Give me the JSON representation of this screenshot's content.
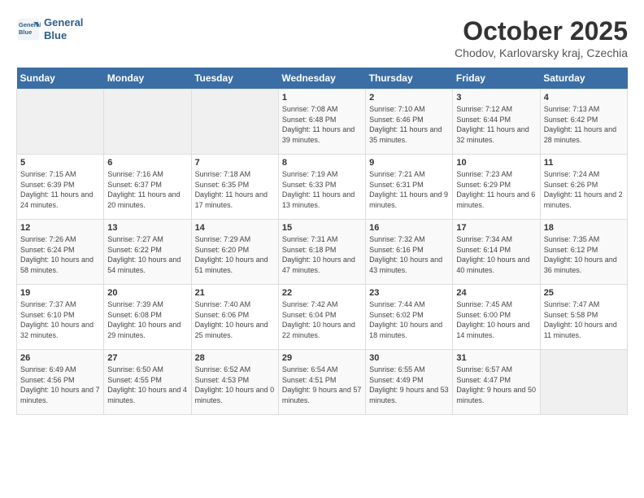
{
  "logo": {
    "line1": "General",
    "line2": "Blue"
  },
  "title": "October 2025",
  "location": "Chodov, Karlovarsky kraj, Czechia",
  "weekdays": [
    "Sunday",
    "Monday",
    "Tuesday",
    "Wednesday",
    "Thursday",
    "Friday",
    "Saturday"
  ],
  "weeks": [
    [
      {
        "day": "",
        "info": ""
      },
      {
        "day": "",
        "info": ""
      },
      {
        "day": "",
        "info": ""
      },
      {
        "day": "1",
        "info": "Sunrise: 7:08 AM\nSunset: 6:48 PM\nDaylight: 11 hours and 39 minutes."
      },
      {
        "day": "2",
        "info": "Sunrise: 7:10 AM\nSunset: 6:46 PM\nDaylight: 11 hours and 35 minutes."
      },
      {
        "day": "3",
        "info": "Sunrise: 7:12 AM\nSunset: 6:44 PM\nDaylight: 11 hours and 32 minutes."
      },
      {
        "day": "4",
        "info": "Sunrise: 7:13 AM\nSunset: 6:42 PM\nDaylight: 11 hours and 28 minutes."
      }
    ],
    [
      {
        "day": "5",
        "info": "Sunrise: 7:15 AM\nSunset: 6:39 PM\nDaylight: 11 hours and 24 minutes."
      },
      {
        "day": "6",
        "info": "Sunrise: 7:16 AM\nSunset: 6:37 PM\nDaylight: 11 hours and 20 minutes."
      },
      {
        "day": "7",
        "info": "Sunrise: 7:18 AM\nSunset: 6:35 PM\nDaylight: 11 hours and 17 minutes."
      },
      {
        "day": "8",
        "info": "Sunrise: 7:19 AM\nSunset: 6:33 PM\nDaylight: 11 hours and 13 minutes."
      },
      {
        "day": "9",
        "info": "Sunrise: 7:21 AM\nSunset: 6:31 PM\nDaylight: 11 hours and 9 minutes."
      },
      {
        "day": "10",
        "info": "Sunrise: 7:23 AM\nSunset: 6:29 PM\nDaylight: 11 hours and 6 minutes."
      },
      {
        "day": "11",
        "info": "Sunrise: 7:24 AM\nSunset: 6:26 PM\nDaylight: 11 hours and 2 minutes."
      }
    ],
    [
      {
        "day": "12",
        "info": "Sunrise: 7:26 AM\nSunset: 6:24 PM\nDaylight: 10 hours and 58 minutes."
      },
      {
        "day": "13",
        "info": "Sunrise: 7:27 AM\nSunset: 6:22 PM\nDaylight: 10 hours and 54 minutes."
      },
      {
        "day": "14",
        "info": "Sunrise: 7:29 AM\nSunset: 6:20 PM\nDaylight: 10 hours and 51 minutes."
      },
      {
        "day": "15",
        "info": "Sunrise: 7:31 AM\nSunset: 6:18 PM\nDaylight: 10 hours and 47 minutes."
      },
      {
        "day": "16",
        "info": "Sunrise: 7:32 AM\nSunset: 6:16 PM\nDaylight: 10 hours and 43 minutes."
      },
      {
        "day": "17",
        "info": "Sunrise: 7:34 AM\nSunset: 6:14 PM\nDaylight: 10 hours and 40 minutes."
      },
      {
        "day": "18",
        "info": "Sunrise: 7:35 AM\nSunset: 6:12 PM\nDaylight: 10 hours and 36 minutes."
      }
    ],
    [
      {
        "day": "19",
        "info": "Sunrise: 7:37 AM\nSunset: 6:10 PM\nDaylight: 10 hours and 32 minutes."
      },
      {
        "day": "20",
        "info": "Sunrise: 7:39 AM\nSunset: 6:08 PM\nDaylight: 10 hours and 29 minutes."
      },
      {
        "day": "21",
        "info": "Sunrise: 7:40 AM\nSunset: 6:06 PM\nDaylight: 10 hours and 25 minutes."
      },
      {
        "day": "22",
        "info": "Sunrise: 7:42 AM\nSunset: 6:04 PM\nDaylight: 10 hours and 22 minutes."
      },
      {
        "day": "23",
        "info": "Sunrise: 7:44 AM\nSunset: 6:02 PM\nDaylight: 10 hours and 18 minutes."
      },
      {
        "day": "24",
        "info": "Sunrise: 7:45 AM\nSunset: 6:00 PM\nDaylight: 10 hours and 14 minutes."
      },
      {
        "day": "25",
        "info": "Sunrise: 7:47 AM\nSunset: 5:58 PM\nDaylight: 10 hours and 11 minutes."
      }
    ],
    [
      {
        "day": "26",
        "info": "Sunrise: 6:49 AM\nSunset: 4:56 PM\nDaylight: 10 hours and 7 minutes."
      },
      {
        "day": "27",
        "info": "Sunrise: 6:50 AM\nSunset: 4:55 PM\nDaylight: 10 hours and 4 minutes."
      },
      {
        "day": "28",
        "info": "Sunrise: 6:52 AM\nSunset: 4:53 PM\nDaylight: 10 hours and 0 minutes."
      },
      {
        "day": "29",
        "info": "Sunrise: 6:54 AM\nSunset: 4:51 PM\nDaylight: 9 hours and 57 minutes."
      },
      {
        "day": "30",
        "info": "Sunrise: 6:55 AM\nSunset: 4:49 PM\nDaylight: 9 hours and 53 minutes."
      },
      {
        "day": "31",
        "info": "Sunrise: 6:57 AM\nSunset: 4:47 PM\nDaylight: 9 hours and 50 minutes."
      },
      {
        "day": "",
        "info": ""
      }
    ]
  ]
}
